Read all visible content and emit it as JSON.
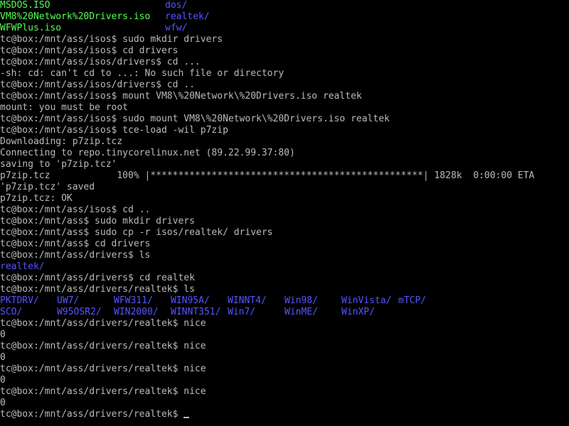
{
  "colors": {
    "background": "#000000",
    "text": "#bbbbbb",
    "file_archive": "#55ff55",
    "directory": "#5555ff"
  },
  "listing_top": [
    {
      "left": "MSDOS.ISO",
      "right": "dos/"
    },
    {
      "left": "VM8%20Network%20Drivers.iso",
      "right": "realtek/"
    },
    {
      "left": "WFWPlus.iso",
      "right": "wfw/"
    }
  ],
  "lines_a": [
    "tc@box:/mnt/ass/isos$ sudo mkdir drivers",
    "tc@box:/mnt/ass/isos$ cd drivers",
    "tc@box:/mnt/ass/isos/drivers$ cd ...",
    "-sh: cd: can't cd to ...: No such file or directory",
    "tc@box:/mnt/ass/isos/drivers$ cd ..",
    "tc@box:/mnt/ass/isos$ mount VM8\\%20Network\\%20Drivers.iso realtek",
    "mount: you must be root",
    "tc@box:/mnt/ass/isos$ sudo mount VM8\\%20Network\\%20Drivers.iso realtek",
    "tc@box:/mnt/ass/isos$ tce-load -wil p7zip",
    "Downloading: p7zip.tcz",
    "Connecting to repo.tinycorelinux.net (89.22.99.37:80)",
    "saving to 'p7zip.tcz'",
    "p7zip.tcz            100% |*************************************************| 1828k  0:00:00 ETA",
    "'p7zip.tcz' saved",
    "p7zip.tcz: OK",
    "tc@box:/mnt/ass/isos$ cd ..",
    "tc@box:/mnt/ass$ sudo mkdir drivers",
    "tc@box:/mnt/ass$ sudo cp -r isos/realtek/ drivers",
    "tc@box:/mnt/ass$ cd drivers",
    "tc@box:/mnt/ass/drivers$ ls"
  ],
  "dir_realtek": "realtek/",
  "lines_b": [
    "tc@box:/mnt/ass/drivers$ cd realtek",
    "tc@box:/mnt/ass/drivers/realtek$ ls"
  ],
  "ls_row1": [
    "PKTDRV/",
    "UW7/",
    "WFW311/",
    "WIN95A/",
    "WINNT4/",
    "Win98/",
    "WinVista/",
    "mTCP/"
  ],
  "ls_row2": [
    "SCO/",
    "W95OSR2/",
    "WIN2000/",
    "WINNT351/",
    "Win7/",
    "WinME/",
    "WinXP/"
  ],
  "lines_c": [
    "tc@box:/mnt/ass/drivers/realtek$ nice",
    "0",
    "tc@box:/mnt/ass/drivers/realtek$ nice",
    "0",
    "tc@box:/mnt/ass/drivers/realtek$ nice",
    "0",
    "tc@box:/mnt/ass/drivers/realtek$ nice",
    "0"
  ],
  "prompt_final": "tc@box:/mnt/ass/drivers/realtek$ "
}
